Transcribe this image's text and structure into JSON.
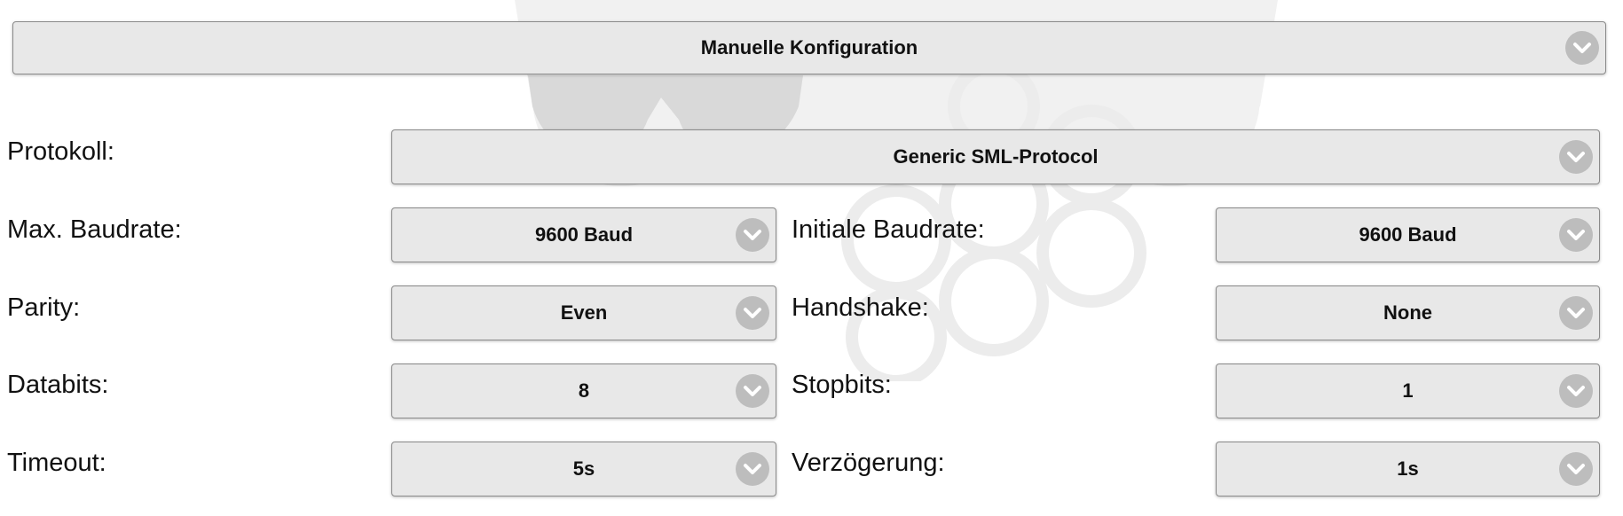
{
  "header": {
    "title": "Manuelle Konfiguration"
  },
  "protocol": {
    "label": "Protokoll:",
    "value": "Generic SML-Protocol"
  },
  "max_baud": {
    "label": "Max. Baudrate:",
    "value": "9600 Baud"
  },
  "init_baud": {
    "label": "Initiale Baudrate:",
    "value": "9600 Baud"
  },
  "parity": {
    "label": "Parity:",
    "value": "Even"
  },
  "handshake": {
    "label": "Handshake:",
    "value": "None"
  },
  "databits": {
    "label": "Databits:",
    "value": "8"
  },
  "stopbits": {
    "label": "Stopbits:",
    "value": "1"
  },
  "timeout": {
    "label": "Timeout:",
    "value": "5s"
  },
  "delay": {
    "label": "Verzögerung:",
    "value": "1s"
  },
  "icons": {
    "dropdown": "chevron-down-icon"
  },
  "colors": {
    "select_bg": "#e8e8e8",
    "chevron_bg": "#bdbdbd",
    "watermark": "#f0f0f0"
  }
}
